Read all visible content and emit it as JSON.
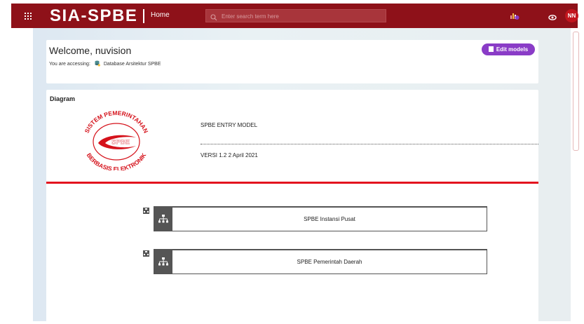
{
  "topbar": {
    "app_title": "SIA-SPBE",
    "home_label": "Home",
    "search_placeholder": "Enter search term here",
    "user_initials": "NN"
  },
  "welcome": {
    "title": "Welcome, nuvision",
    "accessing_label": "You are accessing:",
    "database_name": "Database Arsitektur SPBE",
    "edit_button": "Edit models"
  },
  "diagram": {
    "section_title": "Diagram",
    "seal_text_top": "SISTEM PEMERINTAHAN",
    "seal_text_bottom": "BERBASIS ELEKTRONIK",
    "seal_center": "SPBE",
    "model_name": "SPBE ENTRY MODEL",
    "version": "VERSI 1.2 2 April 2021",
    "nodes": [
      {
        "label": "SPBE Instansi Pusat"
      },
      {
        "label": "SPBE Pemerintah Daerah"
      }
    ]
  },
  "colors": {
    "topbar": "#8e1119",
    "accent_purple": "#8a3cc7",
    "rule_red": "#e3141f",
    "node_gray": "#555555"
  },
  "icons": [
    "waffle-icon",
    "search-icon",
    "notification-icon",
    "eye-icon",
    "database-icon",
    "org-chart-icon"
  ]
}
